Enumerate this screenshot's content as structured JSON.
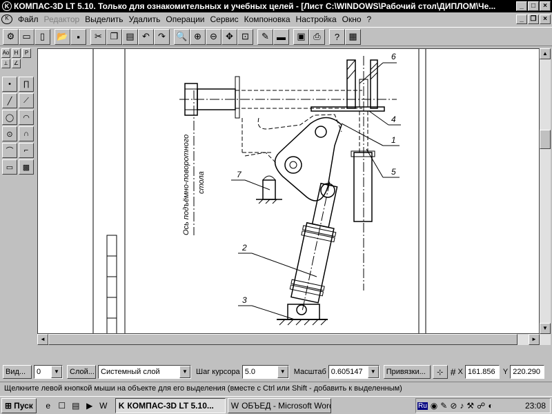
{
  "window": {
    "title": "КОМПАС-3D LT 5.10. Только для ознакомительных и учебных целей - [Лист C:\\WINDOWS\\Рабочий стол\\ДИПЛОМ\\Че...",
    "app_icon": "kompas-icon"
  },
  "menu": {
    "items": [
      {
        "label": "Файл",
        "enabled": true
      },
      {
        "label": "Редактор",
        "enabled": false
      },
      {
        "label": "Выделить",
        "enabled": true
      },
      {
        "label": "Удалить",
        "enabled": true
      },
      {
        "label": "Операции",
        "enabled": true
      },
      {
        "label": "Сервис",
        "enabled": true
      },
      {
        "label": "Компоновка",
        "enabled": true
      },
      {
        "label": "Настройка",
        "enabled": true
      },
      {
        "label": "Окно",
        "enabled": true
      },
      {
        "label": "?",
        "enabled": true
      }
    ]
  },
  "toolbar": {
    "icons": [
      "kompas-icon",
      "new-document-icon",
      "new-sheet-icon",
      "open-folder-icon",
      "save-icon",
      "cut-icon",
      "copy-icon",
      "paste-icon",
      "undo-icon",
      "redo-icon",
      "zoom-icon",
      "zoom-in-icon",
      "zoom-out-icon",
      "pan-icon",
      "zoom-fit-icon",
      "regenerate-icon",
      "layers-icon",
      "print-preview-icon",
      "print-icon",
      "context-help-icon",
      "manager-icon"
    ]
  },
  "left_panel": {
    "tabs": [
      "Ао",
      "Н",
      "Р"
    ],
    "tools": [
      "point-tool",
      "line-tool",
      "circle-tool",
      "arc-tool",
      "ellipse-tool",
      "spline-tool",
      "rectangle-tool",
      "hatch-tool"
    ]
  },
  "drawing": {
    "callouts": [
      "1",
      "2",
      "3",
      "4",
      "5",
      "6",
      "7"
    ],
    "vertical_text_1": "Ось подъёмно-поворотного",
    "vertical_text_2": "стола"
  },
  "property_bar": {
    "view_button": "Вид...",
    "view_value": "0",
    "layer_button": "Слой...",
    "layer_value": "Системный слой",
    "step_label": "Шаг курсора",
    "step_value": "5.0",
    "scale_label": "Масштаб",
    "scale_value": "0.605147",
    "snap_button": "Привязки...",
    "x_label": "X",
    "x_value": "161.856",
    "y_label": "Y",
    "y_value": "220.290"
  },
  "status": {
    "text": "Щелкните левой кнопкой мыши на объекте для его выделения (вместе с Ctrl или Shift - добавить к выделенным)"
  },
  "taskbar": {
    "start_label": "Пуск",
    "tasks": [
      {
        "label": "КОМПАС-3D LT 5.10...",
        "active": true
      },
      {
        "label": "ОБЪЕД - Microsoft Word",
        "active": false
      }
    ],
    "tray_lang": "Ru",
    "clock": "23:08"
  }
}
